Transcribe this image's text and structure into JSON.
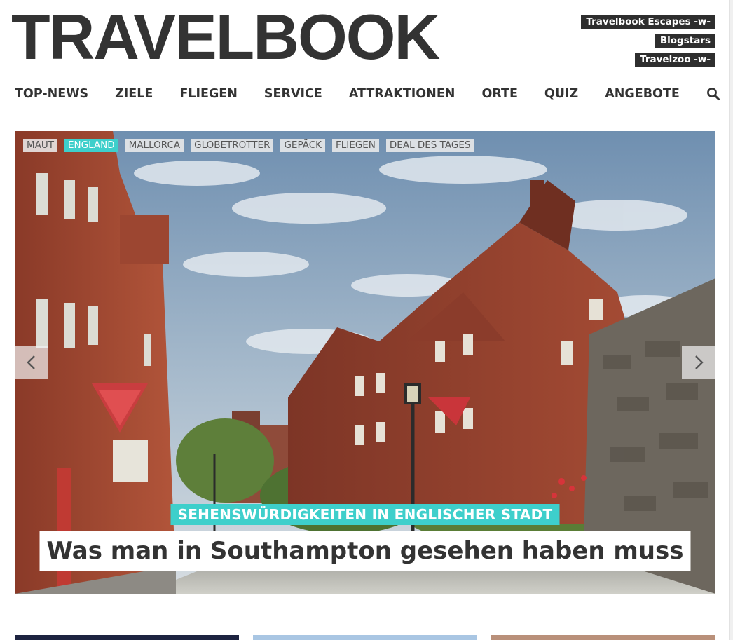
{
  "brand": {
    "logo_text": "TRAVELBOOK"
  },
  "top_links": [
    {
      "label": "Travelbook Escapes -w-"
    },
    {
      "label": "Blogstars"
    },
    {
      "label": "Travelzoo -w-"
    }
  ],
  "nav": {
    "items": [
      {
        "label": "TOP-NEWS"
      },
      {
        "label": "ZIELE"
      },
      {
        "label": "FLIEGEN"
      },
      {
        "label": "SERVICE"
      },
      {
        "label": "ATTRAKTIONEN"
      },
      {
        "label": "ORTE"
      },
      {
        "label": "QUIZ"
      },
      {
        "label": "ANGEBOTE"
      }
    ],
    "search_icon": "search-icon"
  },
  "hero": {
    "tags": [
      {
        "label": "MAUT",
        "active": false
      },
      {
        "label": "ENGLAND",
        "active": true
      },
      {
        "label": "MALLORCA",
        "active": false
      },
      {
        "label": "GLOBETROTTER",
        "active": false
      },
      {
        "label": "GEPÄCK",
        "active": false
      },
      {
        "label": "FLIEGEN",
        "active": false
      },
      {
        "label": "DEAL DES TAGES",
        "active": false
      }
    ],
    "kicker": "SEHENSWÜRDIGKEITEN IN ENGLISCHER STADT",
    "headline": "Was man in Southampton gesehen haben muss",
    "prev_icon": "chevron-left-icon",
    "next_icon": "chevron-right-icon"
  },
  "colors": {
    "accent": "#3ecfcb",
    "text": "#333333",
    "label_bg": "#2e2e2e"
  }
}
